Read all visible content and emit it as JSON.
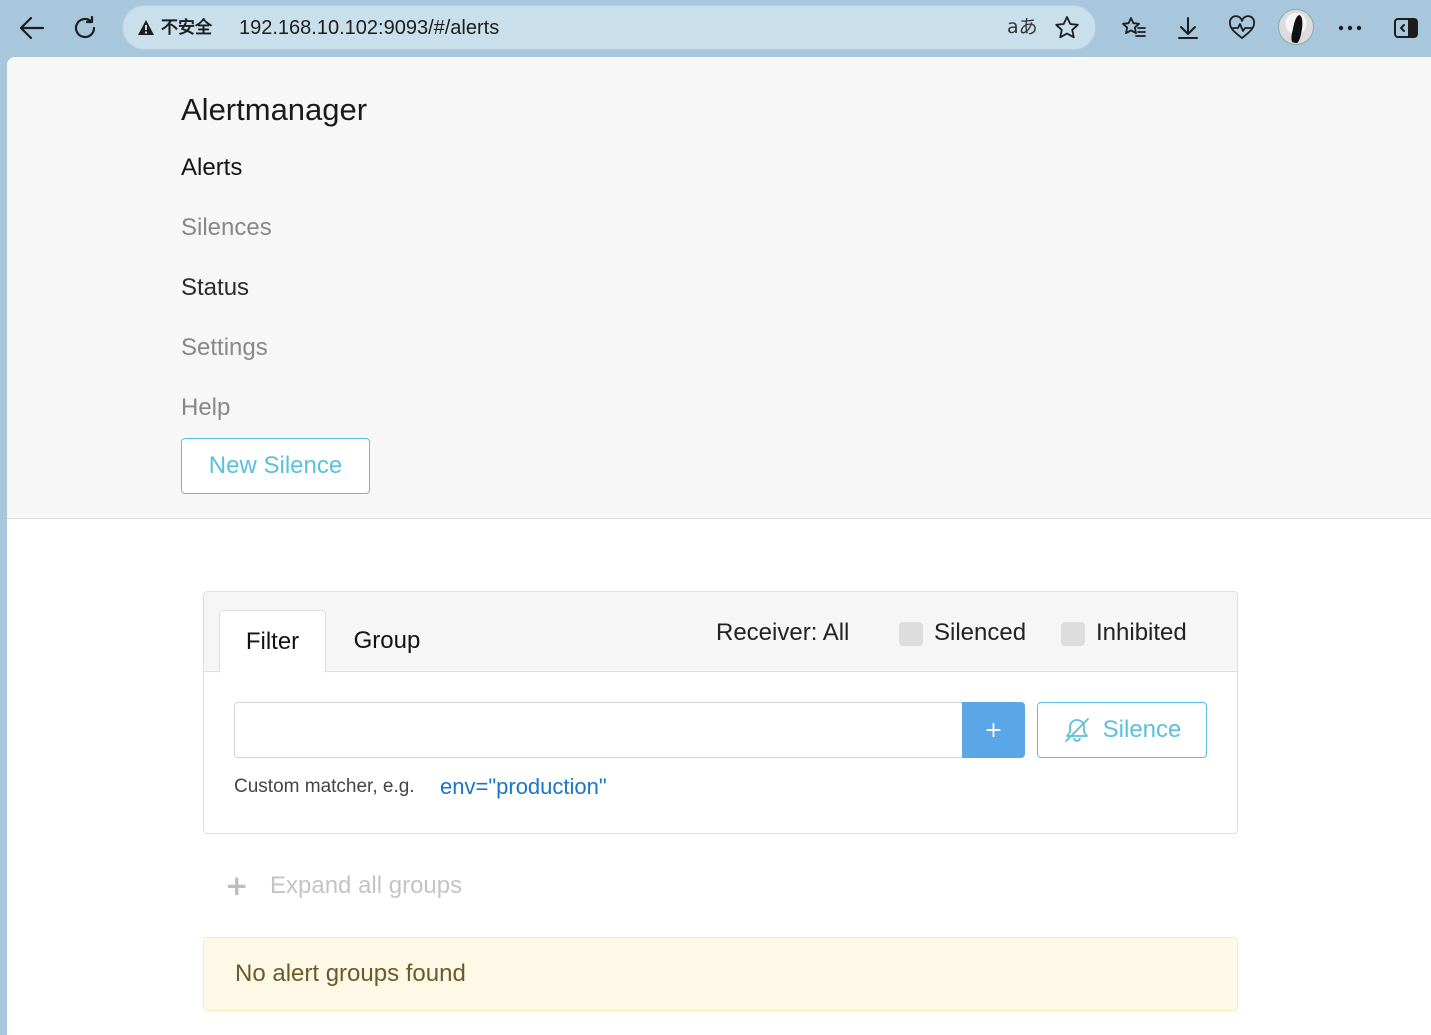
{
  "browser": {
    "security_warning": "不安全",
    "url": "192.168.10.102:9093/#/alerts",
    "read_aloud_label": "aあ",
    "icons": {
      "back": "arrow-left-icon",
      "refresh": "refresh-icon",
      "favorite": "star-icon",
      "favorites_list": "favorites-list-icon",
      "downloads": "download-icon",
      "health": "heartbeat-icon",
      "more": "ellipsis-icon",
      "sidebar": "sidebar-toggle-icon"
    }
  },
  "navbar": {
    "brand": "Alertmanager",
    "items": [
      {
        "label": "Alerts",
        "state": "active"
      },
      {
        "label": "Silences",
        "state": "muted"
      },
      {
        "label": "Status",
        "state": "dark"
      },
      {
        "label": "Settings",
        "state": "muted"
      },
      {
        "label": "Help",
        "state": "muted"
      }
    ],
    "new_silence_label": "New Silence"
  },
  "filter_card": {
    "tabs": [
      {
        "label": "Filter",
        "active": true
      },
      {
        "label": "Group",
        "active": false
      }
    ],
    "receiver_label": "Receiver: All",
    "silenced_label": "Silenced",
    "inhibited_label": "Inhibited",
    "input_value": "",
    "add_button_label": "+",
    "silence_button_label": "Silence",
    "hint_text": "Custom matcher, e.g.",
    "hint_example": "env=\"production\""
  },
  "expand_all_label": "Expand all groups",
  "no_groups_message": "No alert groups found",
  "colors": {
    "accent_info": "#5bc0de",
    "primary": "#5aa6e6",
    "link": "#1a75c9",
    "warning_bg": "#fef8e6"
  }
}
